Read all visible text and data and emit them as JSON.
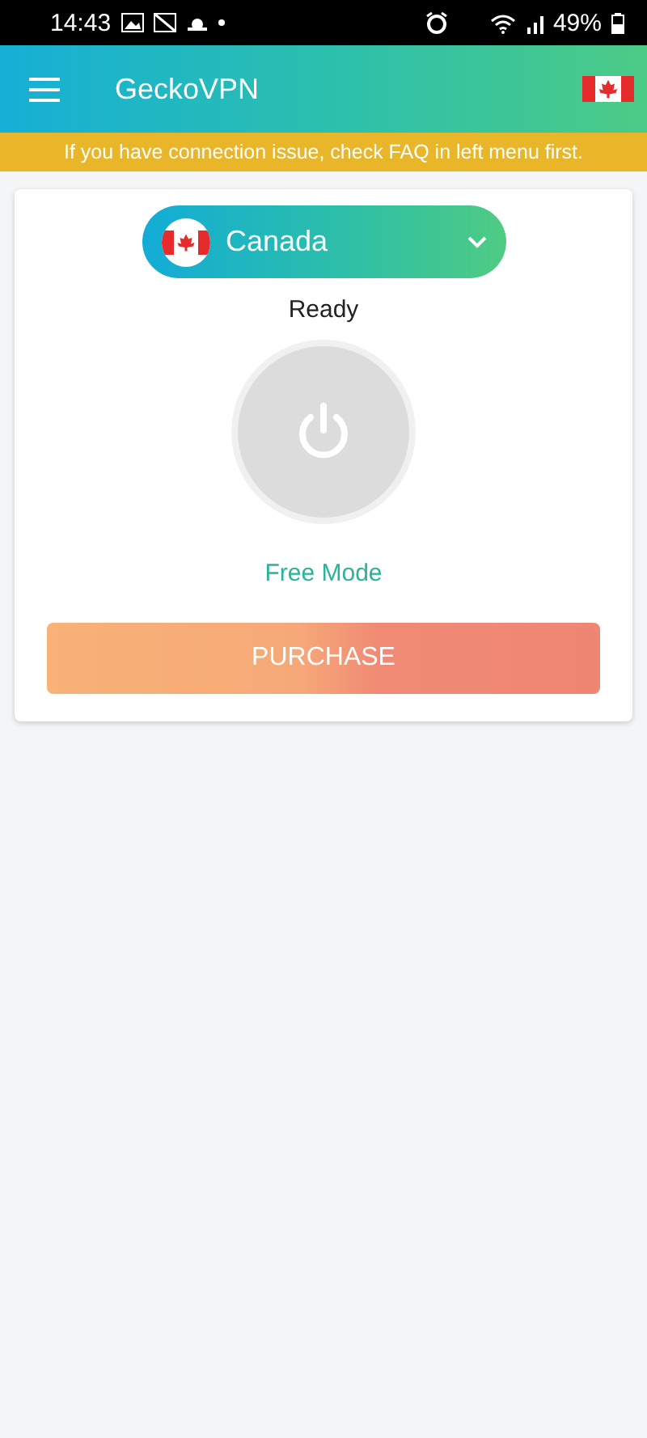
{
  "status_bar": {
    "time": "14:43",
    "battery": "49%"
  },
  "app_bar": {
    "title": "GeckoVPN"
  },
  "notice": "If you have connection issue, check FAQ in left menu first.",
  "country_selector": {
    "country": "Canada"
  },
  "connection": {
    "status": "Ready",
    "connected": false
  },
  "mode": "Free Mode",
  "purchase_button": {
    "label": "PURCHASE"
  }
}
